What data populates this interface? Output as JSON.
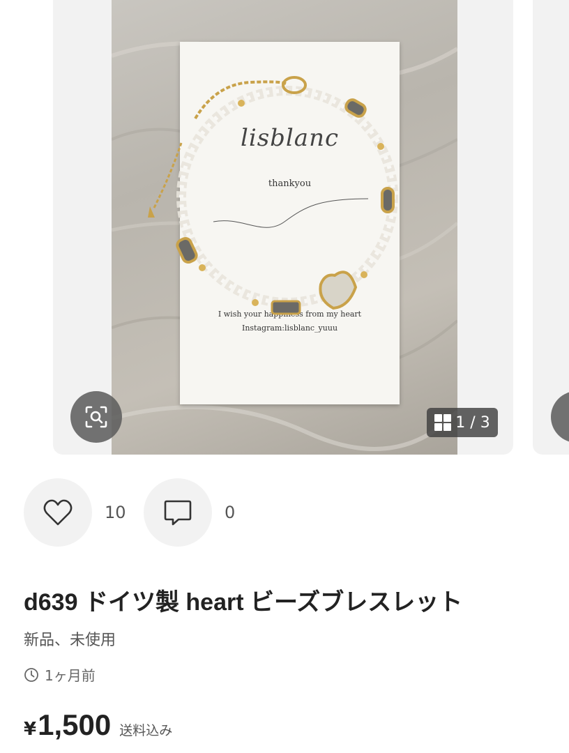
{
  "gallery": {
    "counter": "1 / 3",
    "photo": {
      "card_brand": "lisblanc",
      "card_thanks": "thankyou",
      "card_line1": "I wish your happiness from my heart",
      "card_line2": "Instagram:lisblanc_yuuu"
    }
  },
  "actions": {
    "like_count": "10",
    "comment_count": "0"
  },
  "product": {
    "title": "d639 ドイツ製 heart ビーズブレスレット",
    "condition": "新品、未使用",
    "posted": "1ヶ月前",
    "price_currency": "¥",
    "price": "1,500",
    "price_note": "送料込み"
  },
  "icons": {
    "lens": "image-search-icon",
    "grid": "grid-icon",
    "like": "heart-icon",
    "comment": "comment-icon",
    "clock": "clock-icon"
  }
}
